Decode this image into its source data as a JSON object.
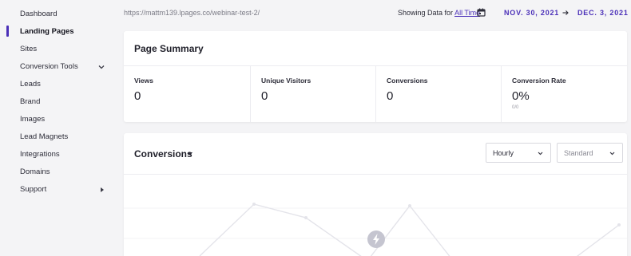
{
  "sidebar": {
    "items": [
      {
        "label": "Dashboard",
        "name": "sidebar-item-dashboard"
      },
      {
        "label": "Landing Pages",
        "name": "sidebar-item-landing-pages",
        "active": true
      },
      {
        "label": "Sites",
        "name": "sidebar-item-sites"
      },
      {
        "label": "Conversion Tools",
        "name": "sidebar-item-conversion-tools",
        "icon": "chevron-down-icon"
      },
      {
        "label": "Leads",
        "name": "sidebar-item-leads"
      },
      {
        "label": "Brand",
        "name": "sidebar-item-brand"
      },
      {
        "label": "Images",
        "name": "sidebar-item-images"
      },
      {
        "label": "Lead Magnets",
        "name": "sidebar-item-lead-magnets"
      },
      {
        "label": "Integrations",
        "name": "sidebar-item-integrations"
      },
      {
        "label": "Domains",
        "name": "sidebar-item-domains"
      },
      {
        "label": "Support",
        "name": "sidebar-item-support",
        "icon": "caret-right-icon"
      }
    ]
  },
  "header": {
    "url": "https://mattm139.lpages.co/webinar-test-2/",
    "showing_prefix": "Showing Data for",
    "showing_link": "All Time",
    "calendar_icon": "calendar-icon",
    "date_start": "NOV. 30, 2021",
    "date_end": "DEC. 3, 2021",
    "arrow_icon": "arrow-right-icon"
  },
  "summary": {
    "title": "Page Summary",
    "stats": [
      {
        "label": "Views",
        "value": "0"
      },
      {
        "label": "Unique Visitors",
        "value": "0"
      },
      {
        "label": "Conversions",
        "value": "0"
      },
      {
        "label": "Conversion Rate",
        "value": "0%",
        "sub": "0/0"
      }
    ]
  },
  "conversions": {
    "title": "Conversions",
    "interval_select": "Hourly",
    "mode_select": "Standard",
    "loading_icon": "bolt-icon"
  },
  "colors": {
    "accent": "#4a2fb8",
    "background": "#f4f4f6",
    "card": "#ffffff",
    "chart_line": "#e4e4ea"
  }
}
